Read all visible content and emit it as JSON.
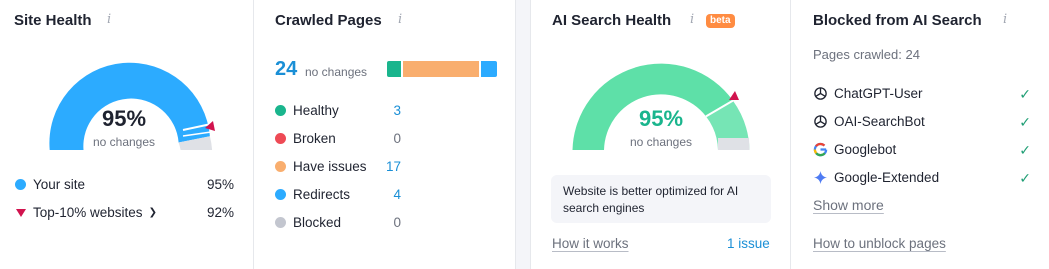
{
  "site_health": {
    "title": "Site Health",
    "info_icon": "i",
    "gauge": {
      "percent": "95%",
      "sub": "no changes",
      "value": 0.95
    },
    "legend": [
      {
        "label": "Your site",
        "value": "95%",
        "color": "#2cabff"
      },
      {
        "label": "Top-10% websites",
        "value": "92%",
        "color": "#d1134e"
      }
    ]
  },
  "crawled_pages": {
    "title": "Crawled Pages",
    "info_icon": "i",
    "count": "24",
    "count_sub": "no changes",
    "segments": [
      {
        "color": "#1ab58d",
        "value": 3
      },
      {
        "color": "#f9ae6e",
        "value": 17
      },
      {
        "color": "#2cabff",
        "value": 4
      }
    ],
    "rows": [
      {
        "label": "Healthy",
        "value": "3",
        "color": "#1ab58d"
      },
      {
        "label": "Broken",
        "value": "0",
        "color": "#ee4a55"
      },
      {
        "label": "Have issues",
        "value": "17",
        "color": "#f9ae6e"
      },
      {
        "label": "Redirects",
        "value": "4",
        "color": "#2cabff"
      },
      {
        "label": "Blocked",
        "value": "0",
        "color": "#c3c6cf"
      }
    ]
  },
  "ai_search_health": {
    "title": "AI Search Health",
    "info_icon": "i",
    "badge": "beta",
    "gauge": {
      "percent": "95%",
      "sub": "no changes",
      "value": 0.95
    },
    "callout": "Website is better optimized for AI search engines",
    "how_it_works": "How it works",
    "issues_link": "1 issue"
  },
  "blocked_ai": {
    "title": "Blocked from AI Search",
    "info_icon": "i",
    "pages_crawled": "Pages crawled: 24",
    "bots": [
      {
        "name": "ChatGPT-User",
        "icon": "openai-icon"
      },
      {
        "name": "OAI-SearchBot",
        "icon": "openai-icon"
      },
      {
        "name": "Googlebot",
        "icon": "google-icon"
      },
      {
        "name": "Google-Extended",
        "icon": "gemini-icon"
      }
    ],
    "show_more": "Show more",
    "unblock_link": "How to unblock pages"
  }
}
